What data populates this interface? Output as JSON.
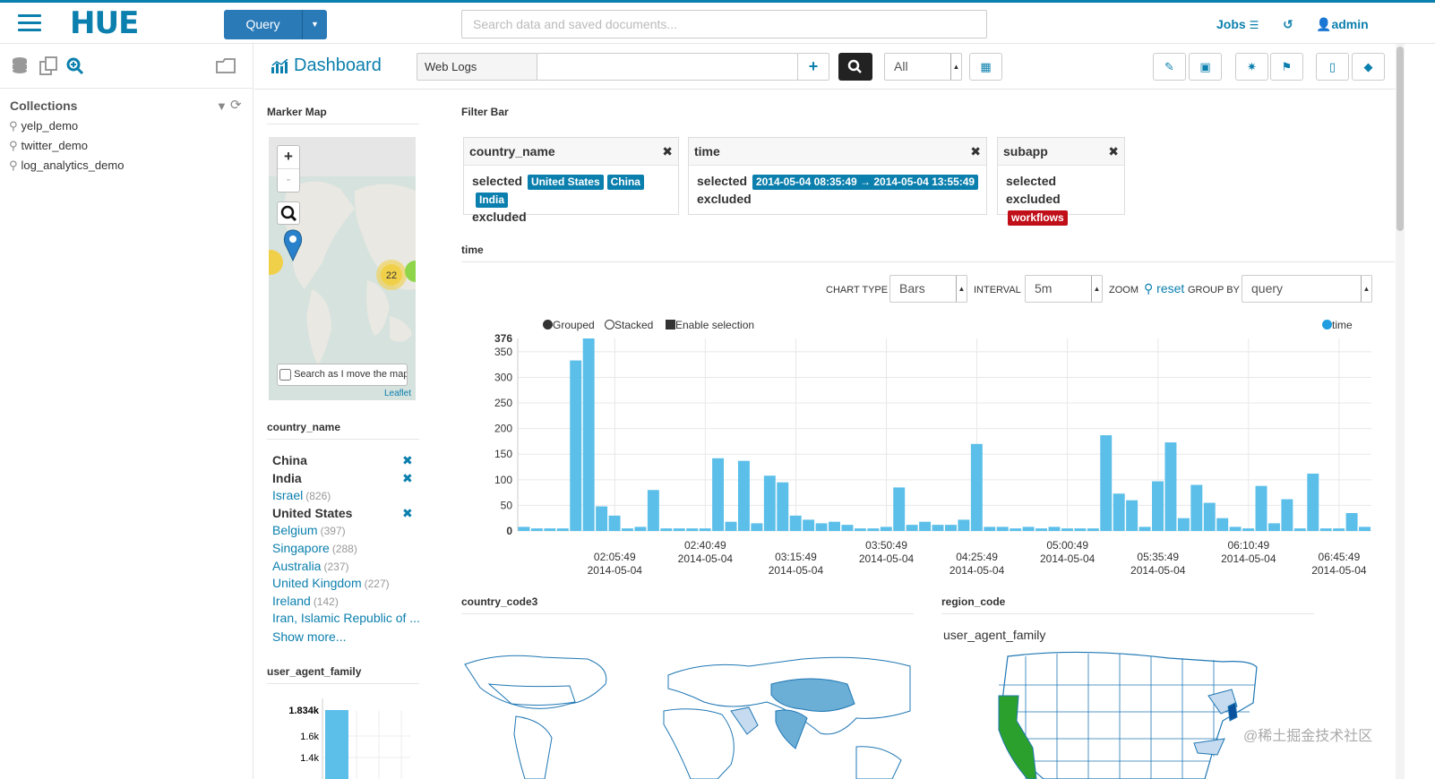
{
  "header": {
    "logo": "HUE",
    "query_label": "Query",
    "search_placeholder": "Search data and saved documents...",
    "jobs_label": "Jobs",
    "user_label": "admin"
  },
  "sidebar": {
    "collections_title": "Collections",
    "items": [
      "yelp_demo",
      "twitter_demo",
      "log_analytics_demo"
    ]
  },
  "dashboard": {
    "title": "Dashboard",
    "collection": "Web Logs",
    "query_value": "",
    "scope": "All"
  },
  "marker_map": {
    "title": "Marker Map",
    "cluster_count": "22",
    "search_move_label": "Search as I move the map",
    "leaflet": "Leaflet",
    "zoom_in": "+",
    "zoom_out": "-"
  },
  "filter_bar": {
    "title": "Filter Bar",
    "cards": [
      {
        "name": "country_name",
        "selected": [
          "United States",
          "China",
          "India"
        ],
        "excluded": []
      },
      {
        "name": "time",
        "selected": [
          "2014-05-04  08:35:49 → 2014-05-04  13:55:49"
        ],
        "excluded": []
      },
      {
        "name": "subapp",
        "selected": [],
        "excluded": [
          "workflows"
        ]
      }
    ],
    "selected_label": "selected",
    "excluded_label": "excluded"
  },
  "country_facet": {
    "title": "country_name",
    "items": [
      {
        "label": "China",
        "count": "",
        "selected": true
      },
      {
        "label": "India",
        "count": "",
        "selected": true
      },
      {
        "label": "Israel",
        "count": "(826)",
        "selected": false
      },
      {
        "label": "United States",
        "count": "",
        "selected": true
      },
      {
        "label": "Belgium",
        "count": "(397)",
        "selected": false
      },
      {
        "label": "Singapore",
        "count": "(288)",
        "selected": false
      },
      {
        "label": "Australia",
        "count": "(237)",
        "selected": false
      },
      {
        "label": "United Kingdom",
        "count": "(227)",
        "selected": false
      },
      {
        "label": "Ireland",
        "count": "(142)",
        "selected": false
      },
      {
        "label": "Iran, Islamic Republic of ...",
        "count": "",
        "selected": false
      }
    ],
    "show_more": "Show more..."
  },
  "uaf_widget": {
    "title": "user_agent_family",
    "ticks": [
      "1.834k",
      "1.6k",
      "1.4k"
    ]
  },
  "time_widget": {
    "title": "time",
    "chart_type_label": "CHART TYPE",
    "chart_type": "Bars",
    "interval_label": "INTERVAL",
    "interval": "5m",
    "zoom_label": "ZOOM",
    "reset_label": "reset",
    "group_by_label": "GROUP BY",
    "group_by": "query",
    "grouped_label": "Grouped",
    "stacked_label": "Stacked",
    "enable_selection_label": "Enable selection",
    "legend_series": "time"
  },
  "country_code3": {
    "title": "country_code3"
  },
  "region_code": {
    "title": "region_code",
    "subtitle": "user_agent_family"
  },
  "watermark": "@稀土掘金技术社区",
  "colors": {
    "accent": "#0b7fad",
    "bar": "#5bbfe9",
    "excluded": "#c00f18"
  },
  "chart_data": {
    "type": "bar",
    "title": "",
    "ylim": [
      0,
      376
    ],
    "yticks": [
      0,
      50,
      100,
      150,
      200,
      250,
      300,
      350,
      376
    ],
    "series": [
      {
        "name": "time",
        "values": [
          8,
          5,
          5,
          5,
          333,
          376,
          48,
          30,
          5,
          8,
          80,
          5,
          5,
          5,
          5,
          142,
          18,
          137,
          15,
          108,
          95,
          30,
          22,
          15,
          18,
          12,
          5,
          5,
          8,
          85,
          12,
          18,
          12,
          12,
          22,
          170,
          8,
          8,
          5,
          8,
          5,
          8,
          5,
          5,
          5,
          187,
          73,
          60,
          8,
          97,
          173,
          25,
          90,
          55,
          25,
          8,
          5,
          88,
          15,
          62,
          5,
          112,
          5,
          5,
          35,
          8
        ]
      }
    ],
    "x_ticks": [
      {
        "time": "02:05:49",
        "date": "2014-05-04",
        "bar": 7
      },
      {
        "time": "02:40:49",
        "date": "2014-05-04",
        "bar": 14
      },
      {
        "time": "03:15:49",
        "date": "2014-05-04",
        "bar": 21
      },
      {
        "time": "03:50:49",
        "date": "2014-05-04",
        "bar": 28
      },
      {
        "time": "04:25:49",
        "date": "2014-05-04",
        "bar": 35
      },
      {
        "time": "05:00:49",
        "date": "2014-05-04",
        "bar": 42
      },
      {
        "time": "05:35:49",
        "date": "2014-05-04",
        "bar": 49
      },
      {
        "time": "06:10:49",
        "date": "2014-05-04",
        "bar": 56
      },
      {
        "time": "06:45:49",
        "date": "2014-05-04",
        "bar": 63
      }
    ]
  }
}
